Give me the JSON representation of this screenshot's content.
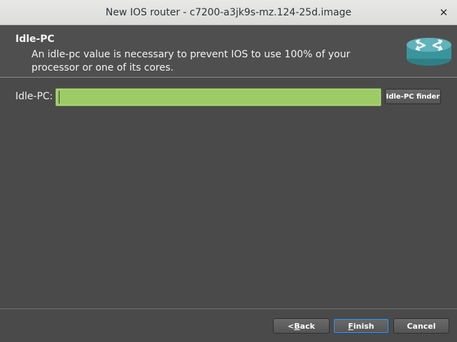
{
  "window": {
    "title": "New IOS router - c7200-a3jk9s-mz.124-25d.image",
    "close_symbol": "✕"
  },
  "header": {
    "title": "Idle-PC",
    "subtitle": "An idle-pc value is necessary to prevent IOS to use 100% of your processor or one of its cores.",
    "icon": "router-icon"
  },
  "form": {
    "idle_pc_label": "Idle-PC:",
    "idle_pc_value": "",
    "finder_label": "Idle-PC finder",
    "input_color": "#9dcb65"
  },
  "footer": {
    "back_prefix": "< ",
    "back_mnemonic": "B",
    "back_rest": "ack",
    "finish_mnemonic": "F",
    "finish_rest": "inish",
    "cancel_label": "Cancel"
  }
}
